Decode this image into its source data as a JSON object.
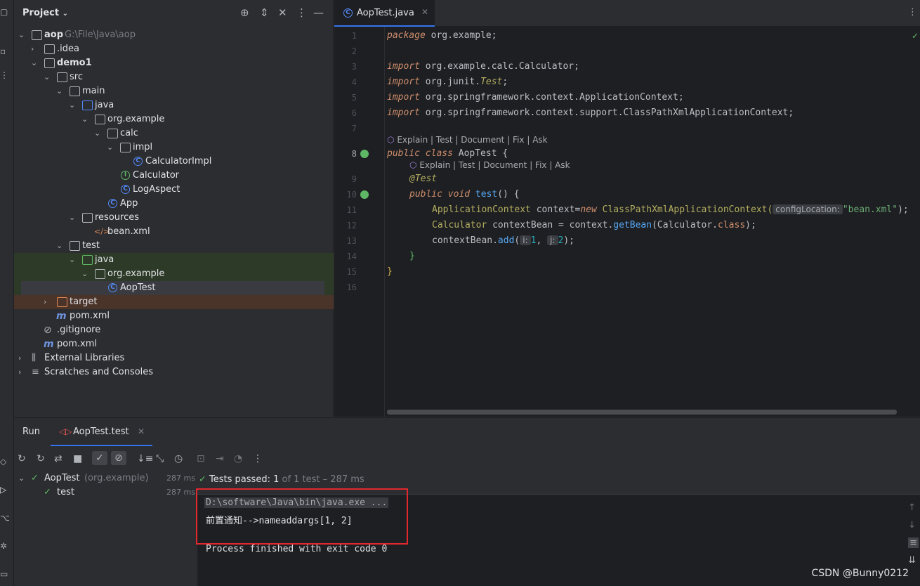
{
  "project": {
    "title": "Project",
    "tree": [
      {
        "label": "aop",
        "path": "G:\\File\\Java\\aop",
        "bold": true
      },
      {
        "label": ".idea"
      },
      {
        "label": "demo1",
        "bold": true
      },
      {
        "label": "src"
      },
      {
        "label": "main"
      },
      {
        "label": "java"
      },
      {
        "label": "org.example"
      },
      {
        "label": "calc"
      },
      {
        "label": "impl"
      },
      {
        "label": "CalculatorImpl"
      },
      {
        "label": "Calculator"
      },
      {
        "label": "LogAspect"
      },
      {
        "label": "App"
      },
      {
        "label": "resources"
      },
      {
        "label": "bean.xml"
      },
      {
        "label": "test"
      },
      {
        "label": "java"
      },
      {
        "label": "org.example"
      },
      {
        "label": "AopTest"
      },
      {
        "label": "target"
      },
      {
        "label": "pom.xml"
      },
      {
        "label": ".gitignore"
      },
      {
        "label": "pom.xml"
      },
      {
        "label": "External Libraries"
      },
      {
        "label": "Scratches and Consoles"
      }
    ]
  },
  "editor": {
    "tab": "AopTest.java",
    "line_numbers": [
      "1",
      "2",
      "3",
      "4",
      "5",
      "6",
      "7",
      "8",
      "9",
      "10",
      "11",
      "12",
      "13",
      "14",
      "15",
      "16"
    ],
    "lens1": "Explain | Test | Document | Fix | Ask",
    "lens2": "Explain | Test | Document | Fix | Ask",
    "code": {
      "l1_kw": "package",
      "l1_rest": " org.example;",
      "l3_kw": "import",
      "l3_rest": " org.example.calc.Calculator;",
      "l4_kw": "import",
      "l4_a": " org.junit.",
      "l4_b": "Test",
      "l4_c": ";",
      "l5_kw": "import",
      "l5_rest": " org.springframework.context.ApplicationContext;",
      "l6_kw": "import",
      "l6_rest": " org.springframework.context.support.ClassPathXmlApplicationContext;",
      "l8_kw": "public class",
      "l8_rest": " AopTest {",
      "l9": "@Test",
      "l10_kw": "public void",
      "l10_m": " test",
      "l10_rest": "() {",
      "l11_a": "ApplicationContext",
      "l11_b": " context=",
      "l11_kw": "new",
      "l11_c": " ClassPathXmlApplicationContext(",
      "l11_hint": "configLocation:",
      "l11_str": "\"bean.xml\"",
      "l11_end": ");",
      "l12_a": "Calculator",
      "l12_b": " contextBean = context.",
      "l12_m": "getBean",
      "l12_c": "(Calculator.",
      "l12_kw": "class",
      "l12_end": ");",
      "l13_a": "contextBean.",
      "l13_m": "add",
      "l13_b": "(",
      "l13_hint1": "i:",
      "l13_n1": "1",
      "l13_c": ", ",
      "l13_hint2": "j:",
      "l13_n2": "2",
      "l13_end": ");",
      "l14": "}",
      "l15": "}"
    }
  },
  "run": {
    "title": "Run",
    "tab": "AopTest.test",
    "tests_passed_label": "Tests passed:",
    "tests_passed_count": "1",
    "tests_passed_rest": "of 1 test – 287 ms",
    "tree": [
      {
        "label": "AopTest",
        "suffix": "(org.example)",
        "time": "287 ms"
      },
      {
        "label": "test",
        "time": "287 ms"
      }
    ],
    "console": [
      "D:\\software\\Java\\bin\\java.exe ...",
      "前置通知-->nameaddargs[1, 2]",
      "Process finished with exit code 0"
    ]
  },
  "watermark": "CSDN @Bunny0212",
  "colors": {
    "accent": "#3574f0",
    "highlight_red": "#e0282e",
    "pass_green": "#5fb865"
  }
}
